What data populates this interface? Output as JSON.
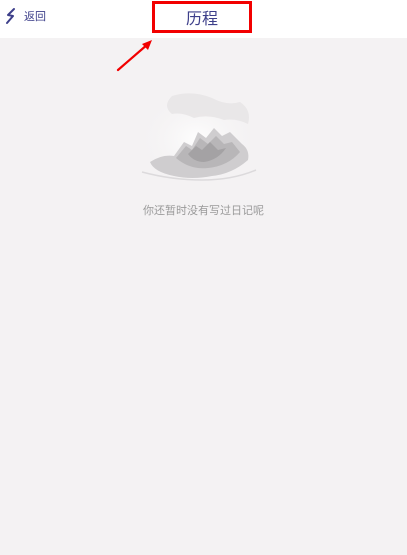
{
  "header": {
    "back_label": "返回",
    "title": "历程"
  },
  "empty_state": {
    "message": "你还暂时没有写过日记呢"
  },
  "colors": {
    "background": "#f4f2f3",
    "nav_text": "#3d3f8a",
    "highlight": "#f20000",
    "muted_text": "#9a9a9a"
  },
  "icons": {
    "back": "back-feather-icon",
    "illustration": "mountain-landscape-icon"
  }
}
